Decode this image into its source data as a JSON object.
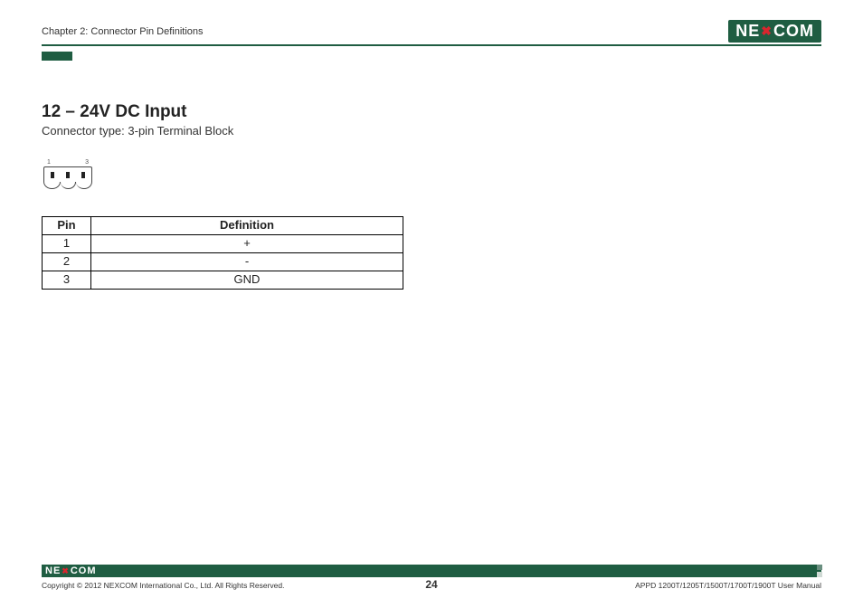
{
  "header": {
    "chapter": "Chapter 2: Connector Pin Definitions",
    "logo_pre": "NE",
    "logo_x": "✖",
    "logo_post": "COM"
  },
  "section": {
    "title": "12 – 24V DC Input",
    "subtitle": "Connector type: 3-pin Terminal Block",
    "pin_left": "1",
    "pin_right": "3"
  },
  "table": {
    "headers": {
      "pin": "Pin",
      "def": "Definition"
    },
    "rows": [
      {
        "pin": "1",
        "def": "+"
      },
      {
        "pin": "2",
        "def": "-"
      },
      {
        "pin": "3",
        "def": "GND"
      }
    ]
  },
  "footer": {
    "copyright": "Copyright © 2012 NEXCOM International Co., Ltd. All Rights Reserved.",
    "page": "24",
    "manual": "APPD 1200T/1205T/1500T/1700T/1900T User Manual"
  }
}
